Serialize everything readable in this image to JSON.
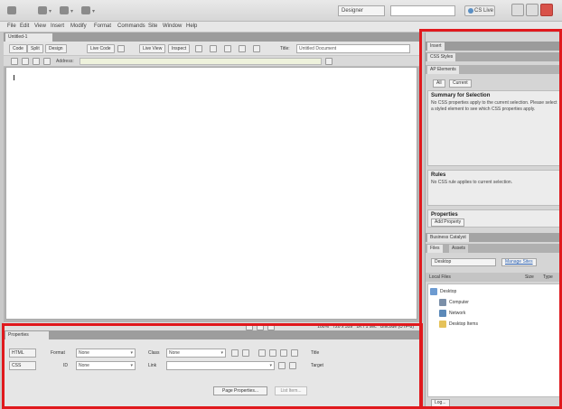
{
  "app": {
    "workspace": "Designer",
    "cs_live": "CS Live"
  },
  "menu": [
    "File",
    "Edit",
    "View",
    "Insert",
    "Modify",
    "Format",
    "Commands",
    "Site",
    "Window",
    "Help"
  ],
  "document": {
    "tab": "Untitled-1",
    "view_buttons": [
      "Code",
      "Split",
      "Design",
      "Live Code",
      "Live View",
      "Inspect"
    ],
    "title_label": "Title:",
    "title_value": "Untitled Document",
    "address_label": "Address:"
  },
  "status": {
    "zoom": "100%",
    "size": "720 x 359",
    "weight": "1K / 1 sec",
    "encoding": "Unicode (UTF-8)"
  },
  "properties": {
    "title": "Properties",
    "html_button": "HTML",
    "css_button": "CSS",
    "format_label": "Format",
    "format_value": "None",
    "class_label": "Class",
    "class_value": "None",
    "id_label": "ID",
    "id_value": "None",
    "link_label": "Link",
    "title_label": "Title",
    "target_label": "Target",
    "page_properties": "Page Properties...",
    "list_item": "List Item..."
  },
  "right_panel": {
    "insert_tab": "Insert",
    "css_styles_tab": "CSS Styles",
    "ap_elements_tab": "AP Elements",
    "all_label": "All",
    "current_label": "Current",
    "summary_heading": "Summary for Selection",
    "summary_text": "No CSS properties apply to the current selection. Please select a styled element to see which CSS properties apply.",
    "rules_heading": "Rules",
    "rules_text": "No CSS rule applies to current selection.",
    "properties_heading": "Properties",
    "add_property": "Add Property",
    "assets_tab": "Business Catalyst",
    "files_tab": "Files",
    "assets_sub": "Assets",
    "site_select": "Desktop",
    "manage_sites": "Manage Sites",
    "local_files": "Local Files",
    "size_col": "Size",
    "type_col": "Type",
    "tree": [
      "Desktop",
      "Computer",
      "Network",
      "Desktop Items"
    ],
    "log": "Log..."
  },
  "highlight_color": "#e0191d"
}
